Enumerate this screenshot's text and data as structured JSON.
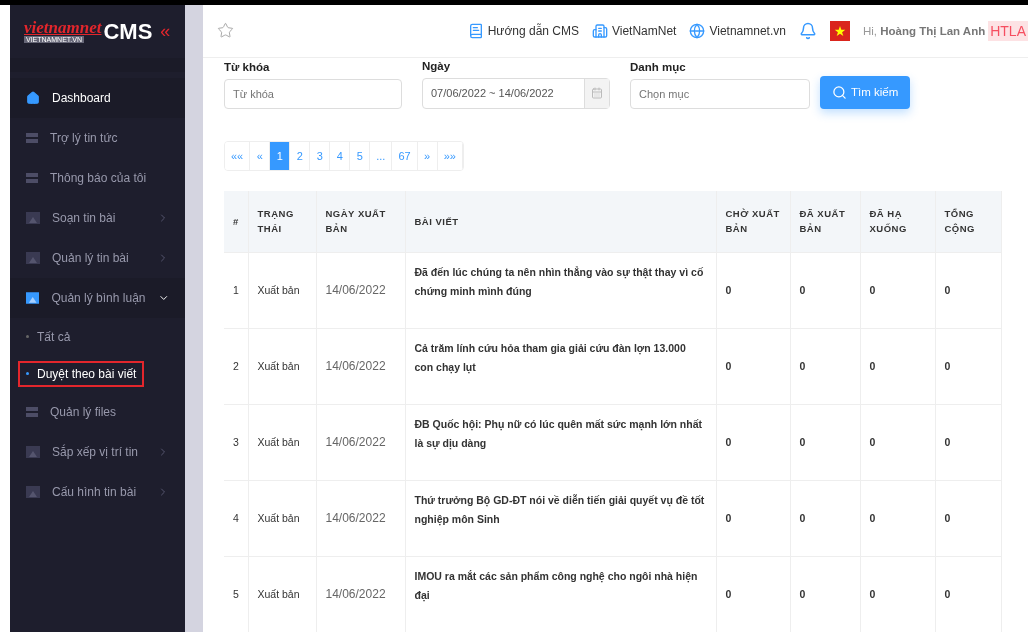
{
  "sidebar": {
    "logo": {
      "brand": "vietnamnet",
      "sub": "VIETNAMNET.VN",
      "product": "CMS",
      "collapse": "«"
    },
    "items": [
      {
        "label": "Dashboard",
        "kind": "home",
        "selected": true
      },
      {
        "label": "Trợ lý tin tức",
        "kind": "list",
        "selected": false
      },
      {
        "label": "Thông báo của tôi",
        "kind": "list",
        "selected": false
      },
      {
        "label": "Soạn tin bài",
        "kind": "folder",
        "selected": false,
        "expanded": false
      },
      {
        "label": "Quản lý tin bài",
        "kind": "folder",
        "selected": false,
        "expanded": false
      },
      {
        "label": "Quản lý bình luận",
        "kind": "folder",
        "selected": false,
        "expanded": true,
        "children": [
          {
            "label": "Tất cả",
            "selected": false
          },
          {
            "label": "Duyệt theo bài viết",
            "selected": true
          }
        ]
      },
      {
        "label": "Quản lý files",
        "kind": "list",
        "selected": false
      },
      {
        "label": "Sắp xếp vị trí tin",
        "kind": "folder",
        "selected": false,
        "expanded": false
      },
      {
        "label": "Cấu hình tin bài",
        "kind": "folder",
        "selected": false,
        "expanded": false
      }
    ]
  },
  "header": {
    "links": [
      {
        "label": "Hướng dẫn CMS",
        "kind": "book"
      },
      {
        "label": "VietNamNet",
        "kind": "building"
      },
      {
        "label": "Vietnamnet.vn",
        "kind": "globe"
      }
    ],
    "greeting": "Hi, **Hoàng Thị Lan Anh**",
    "avatar": "HTLA"
  },
  "filters": {
    "keyword": {
      "label": "Từ khóa",
      "placeholder": "Từ khóa"
    },
    "date": {
      "label": "Ngày",
      "value": "07/06/2022 ~ 14/06/2022"
    },
    "category": {
      "label": "Danh mục",
      "placeholder": "Chọn mục"
    },
    "search_button": "Tìm kiếm"
  },
  "pagination": [
    {
      "label": "««",
      "selected": false
    },
    {
      "label": "«",
      "selected": false
    },
    {
      "label": "1",
      "selected": true
    },
    {
      "label": "2",
      "selected": false
    },
    {
      "label": "3",
      "selected": false
    },
    {
      "label": "4",
      "selected": false
    },
    {
      "label": "5",
      "selected": false
    },
    {
      "label": "...",
      "selected": false
    },
    {
      "label": "67",
      "selected": false
    },
    {
      "label": "»",
      "selected": false
    },
    {
      "label": "»»",
      "selected": false
    }
  ],
  "table": {
    "columns": [
      "#",
      "TRẠNG THÁI",
      "NGÀY XUẤT BẢN",
      "BÀI VIẾT",
      "CHỜ XUẤT BẢN",
      "ĐÃ XUẤT BẢN",
      "ĐÃ HẠ XUỐNG",
      "TỔNG CỘNG"
    ],
    "rows": [
      [
        "1",
        "Xuất bản",
        "14/06/2022",
        "Đã đến lúc chúng ta nên nhìn thẳng vào sự thật thay vì cố chứng minh mình đúng",
        "0",
        "0",
        "0",
        "0"
      ],
      [
        "2",
        "Xuất bản",
        "14/06/2022",
        "Cả trăm lính cứu hỏa tham gia giải cứu đàn lợn 13.000 con chạy lụt",
        "0",
        "0",
        "0",
        "0"
      ],
      [
        "3",
        "Xuất bản",
        "14/06/2022",
        "ĐB Quốc hội: Phụ nữ có lúc quên mất sức mạnh lớn nhất là sự dịu dàng",
        "0",
        "0",
        "0",
        "0"
      ],
      [
        "4",
        "Xuất bản",
        "14/06/2022",
        "Thứ trưởng Bộ GD-ĐT nói về diễn tiến giải quyết vụ đề tốt nghiệp môn Sinh",
        "0",
        "0",
        "0",
        "0"
      ],
      [
        "5",
        "Xuất bản",
        "14/06/2022",
        "IMOU ra mắt các sản phẩm công nghệ cho ngôi nhà hiện đại",
        "0",
        "0",
        "0",
        "0"
      ]
    ]
  }
}
